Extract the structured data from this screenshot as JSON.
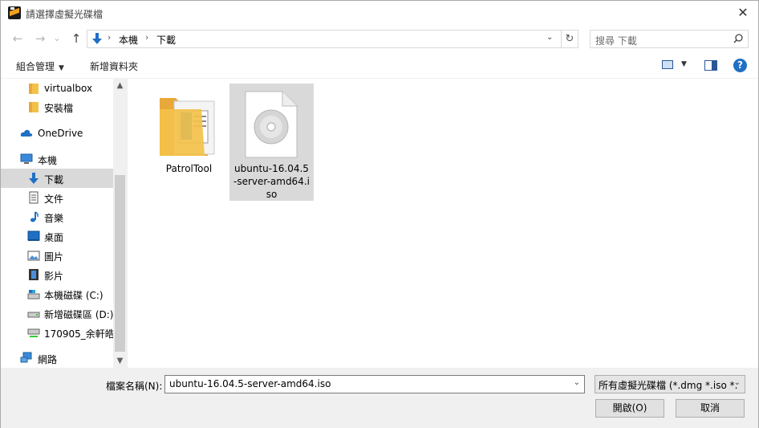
{
  "window": {
    "title": "請選擇虛擬光碟檔",
    "close_symbol": "✕"
  },
  "nav": {
    "back_symbol": "←",
    "forward_symbol": "→",
    "recent_symbol": "⌄",
    "up_symbol": "↑",
    "breadcrumbs": [
      "本機",
      "下載"
    ],
    "crumb_separator": "›",
    "dropdown_symbol": "⌄",
    "refresh_symbol": "↻",
    "search_placeholder": "搜尋 下載"
  },
  "toolbar": {
    "organize_label": "組合管理",
    "organize_caret": "▼",
    "new_folder_label": "新增資料夾",
    "view_caret": "▼",
    "help_symbol": "?"
  },
  "sidebar": {
    "items": [
      {
        "label": "virtualbox",
        "icon": "folder-icon"
      },
      {
        "label": "安裝檔",
        "icon": "folder-icon"
      },
      {
        "label": "OneDrive",
        "icon": "cloud-icon"
      },
      {
        "label": "本機",
        "icon": "computer-icon"
      },
      {
        "label": "下載",
        "icon": "download-icon"
      },
      {
        "label": "文件",
        "icon": "document-icon"
      },
      {
        "label": "音樂",
        "icon": "music-icon"
      },
      {
        "label": "桌面",
        "icon": "desktop-icon"
      },
      {
        "label": "圖片",
        "icon": "pictures-icon"
      },
      {
        "label": "影片",
        "icon": "video-icon"
      },
      {
        "label": "本機磁碟 (C:)",
        "icon": "drive-icon"
      },
      {
        "label": "新增磁碟區 (D:)",
        "icon": "drive-icon"
      },
      {
        "label": "170905_余軒皓",
        "icon": "network-drive-icon"
      },
      {
        "label": "網路",
        "icon": "network-icon"
      }
    ],
    "selected_index": 4,
    "scroll_up": "▲",
    "scroll_down": "▼"
  },
  "files": [
    {
      "name": "PatrolTool",
      "type": "folder"
    },
    {
      "name": "ubuntu-16.04.5-server-amd64.iso",
      "type": "disc-image"
    }
  ],
  "selected_file": "ubuntu-16.04.5-server-amd64.iso",
  "bottom": {
    "filename_label": "檔案名稱(N):",
    "filename_value": "ubuntu-16.04.5-server-amd64.iso",
    "dropdown_symbol": "⌄",
    "filter_value": "所有虛擬光碟檔 (*.dmg *.iso *.",
    "open_label": "開啟(O)",
    "cancel_label": "取消"
  },
  "colors": {
    "accent": "#1f6fc5",
    "selection": "#d9d9d9",
    "folder": "#f3c14a",
    "panel": "#f0f0f0"
  }
}
